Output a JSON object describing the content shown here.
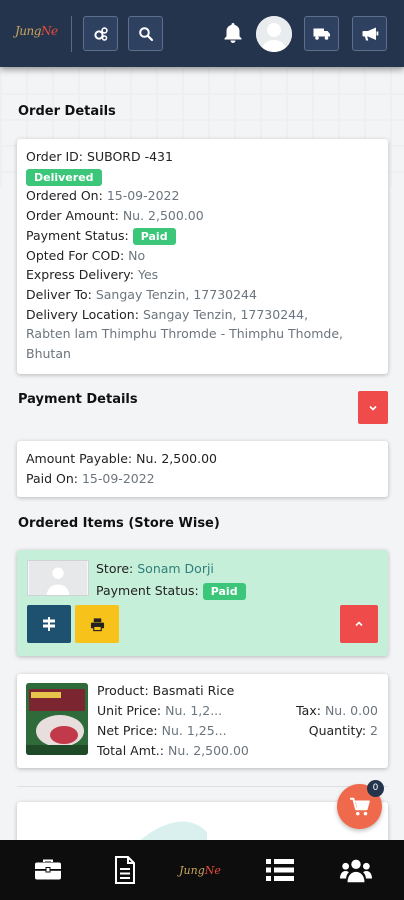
{
  "header": {
    "logo_text": "Jung",
    "logo_accent": "Ne"
  },
  "order_details": {
    "title": "Order Details",
    "order_id_label": "Order ID:",
    "order_id_value": "SUBORD -431",
    "status_badge": "Delivered",
    "ordered_on_label": "Ordered On:",
    "ordered_on_value": "15-09-2022",
    "order_amount_label": "Order Amount:",
    "order_amount_value": "Nu. 2,500.00",
    "payment_status_label": "Payment Status:",
    "payment_status_badge": "Paid",
    "cod_label": "Opted For COD:",
    "cod_value": "No",
    "express_label": "Express Delivery:",
    "express_value": "Yes",
    "deliver_to_label": "Deliver To:",
    "deliver_to_value": "Sangay Tenzin, 17730244",
    "location_label": "Delivery Location:",
    "location_line1": "Sangay Tenzin, 17730244,",
    "location_line2": "Rabten lam Thimphu Thromde - Thimphu Thomde,",
    "location_line3": "Bhutan"
  },
  "payment_details": {
    "title": "Payment Details",
    "amount_payable_label": "Amount Payable:",
    "amount_payable_value": "Nu. 2,500.00",
    "paid_on_label": "Paid On:",
    "paid_on_value": "15-09-2022"
  },
  "ordered_items": {
    "title": "Ordered Items (Store Wise)",
    "store_label": "Store:",
    "store_value": "Sonam Dorji",
    "payment_status_label": "Payment Status:",
    "payment_status_badge": "Paid"
  },
  "product": {
    "product_label": "Product:",
    "product_value": "Basmati Rice",
    "unit_price_label": "Unit Price:",
    "unit_price_value": "Nu. 1,2...",
    "tax_label": "Tax:",
    "tax_value": "Nu. 0.00",
    "net_price_label": "Net Price:",
    "net_price_value": "Nu. 1,25...",
    "quantity_label": "Quantity:",
    "quantity_value": "2",
    "total_label": "Total Amt.:",
    "total_value": "Nu. 2,500.00"
  },
  "cart": {
    "count": "0"
  },
  "bottom_nav": {
    "logo_text": "Jung",
    "logo_accent": "Ne"
  },
  "colors": {
    "header_bg": "#24344d",
    "success_badge": "#3cc67a",
    "store_card_bg": "#c6efd9",
    "danger": "#ef4b4b",
    "link": "#2f7f7a",
    "fab": "#ef6a4c"
  }
}
